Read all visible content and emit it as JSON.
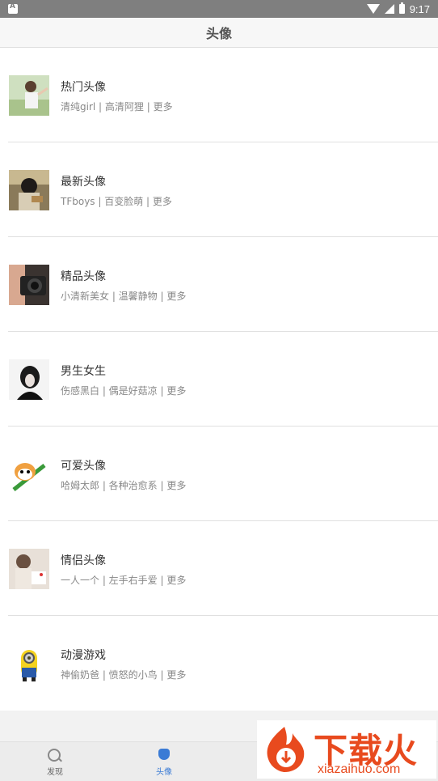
{
  "status": {
    "time": "9:17"
  },
  "header": {
    "title": "头像"
  },
  "categories": [
    {
      "title": "热门头像",
      "subtitle": "清纯girl | 高清阿狸 | 更多"
    },
    {
      "title": "最新头像",
      "subtitle": "TFboys | 百变脸萌 | 更多"
    },
    {
      "title": "精品头像",
      "subtitle": "小清新美女 | 温馨静物 | 更多"
    },
    {
      "title": "男生女生",
      "subtitle": "伤感黑白 | 偶是好菇凉 | 更多"
    },
    {
      "title": "可爱头像",
      "subtitle": "哈姆太郎 | 各种治愈系 | 更多"
    },
    {
      "title": "情侣头像",
      "subtitle": "一人一个 | 左手右手爱 | 更多"
    },
    {
      "title": "动漫游戏",
      "subtitle": "神偷奶爸 | 愤怒的小鸟 | 更多"
    }
  ],
  "tabs": {
    "discover": "发现",
    "avatar": "头像"
  },
  "watermark": {
    "brand": "下载火",
    "url": "xiazaihuo.com"
  },
  "colors": {
    "accent": "#3a7bd5",
    "watermark": "#e84a1e"
  }
}
